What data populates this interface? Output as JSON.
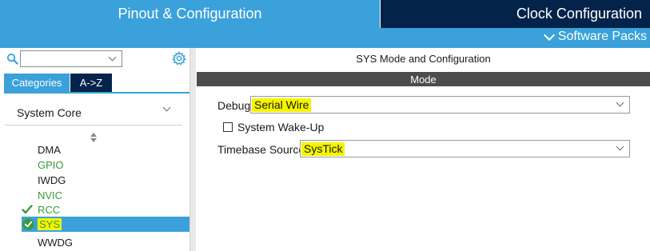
{
  "header": {
    "tabs": [
      {
        "label": "Pinout & Configuration",
        "active": true
      },
      {
        "label": "Clock Configuration",
        "active": false
      }
    ],
    "software_packs_label": "Software Packs"
  },
  "left_panel": {
    "search": {
      "value": "",
      "placeholder": ""
    },
    "tabs": [
      {
        "label": "Categories",
        "active": true
      },
      {
        "label": "A->Z",
        "active": false
      }
    ],
    "category": "System Core",
    "items": [
      {
        "label": "DMA",
        "color": "#1a1a1a",
        "checked": false
      },
      {
        "label": "GPIO",
        "color": "#3a9a3a",
        "checked": false
      },
      {
        "label": "IWDG",
        "color": "#1a1a1a",
        "checked": false
      },
      {
        "label": "NVIC",
        "color": "#3a9a3a",
        "checked": false
      },
      {
        "label": "RCC",
        "color": "#3a9a3a",
        "checked": true
      },
      {
        "label": "SYS",
        "color": "#3a9a3a",
        "checked": true,
        "selected": true
      },
      {
        "label": "WWDG",
        "color": "#1a1a1a",
        "checked": false
      }
    ]
  },
  "main": {
    "title": "SYS Mode and Configuration",
    "mode_header": "Mode",
    "debug": {
      "label": "Debug",
      "value": "Serial Wire"
    },
    "wakeup": {
      "label": "System Wake-Up",
      "checked": false
    },
    "timebase": {
      "label": "Timebase Source",
      "value": "SysTick"
    }
  },
  "colors": {
    "accent_blue": "#3aa1da",
    "dark_navy": "#03234b",
    "mode_bar": "#4c4c4c",
    "highlight_yellow": "#f5f500",
    "ok_green": "#3a9a3a"
  }
}
